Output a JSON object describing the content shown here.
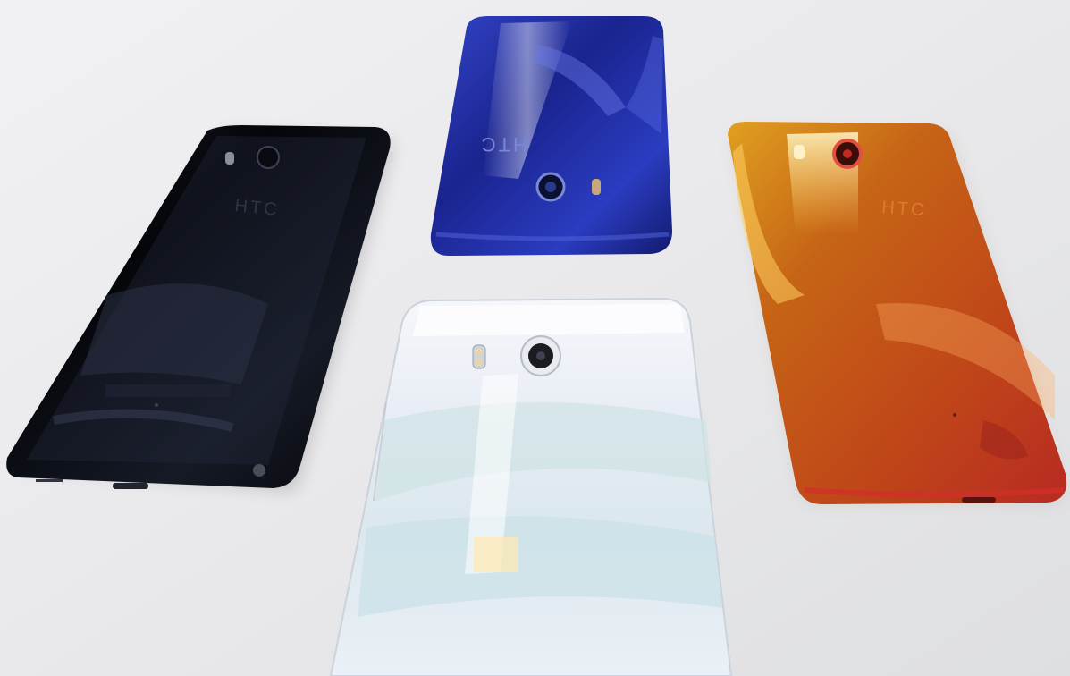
{
  "photo": {
    "brand_text": "HTC",
    "phones": [
      {
        "name": "black",
        "color": "#0b0d14"
      },
      {
        "name": "blue",
        "color": "#1f2fa8"
      },
      {
        "name": "red-orange",
        "color": "#c9591a"
      },
      {
        "name": "white",
        "color": "#eef3f8"
      }
    ],
    "background_color": "#e9eaec"
  }
}
